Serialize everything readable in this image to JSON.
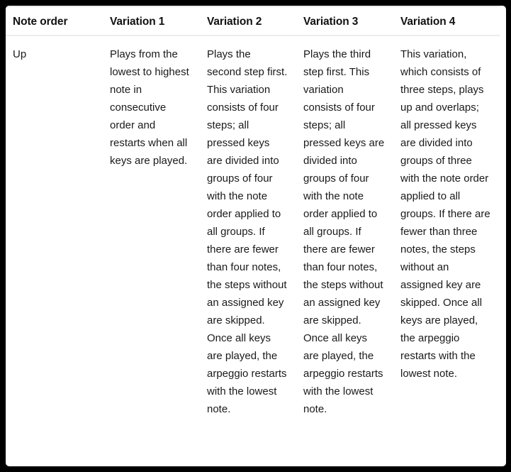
{
  "table": {
    "headers": [
      "Note order",
      "Variation 1",
      "Variation 2",
      "Variation 3",
      "Variation 4"
    ],
    "rows": [
      {
        "note_order": "Up",
        "variation_1": "Plays from the lowest to highest note in consecutive order and restarts when all keys are played.",
        "variation_2": "Plays the second step first. This variation consists of four steps; all pressed keys are divided into groups of four with the note order applied to all groups. If there are fewer than four notes, the steps without an assigned key are skipped. Once all keys are played, the arpeggio restarts with the lowest note.",
        "variation_3": "Plays the third step first. This variation consists of four steps; all pressed keys are divided into groups of four with the note order applied to all groups. If there are fewer than four notes, the steps without an assigned key are skipped. Once all keys are played, the arpeggio restarts with the lowest note.",
        "variation_4": "This variation, which consists of three steps, plays up and overlaps; all pressed keys are divided into groups of three with the note order applied to all groups. If there are fewer than three notes, the steps without an assigned key are skipped. Once all keys are played, the arpeggio restarts with the lowest note."
      }
    ]
  },
  "colors": {
    "frame": "#000000",
    "card": "#ffffff",
    "rule": "#e9e9e9",
    "header_text": "#111111",
    "body_text": "#1a1a1a"
  }
}
